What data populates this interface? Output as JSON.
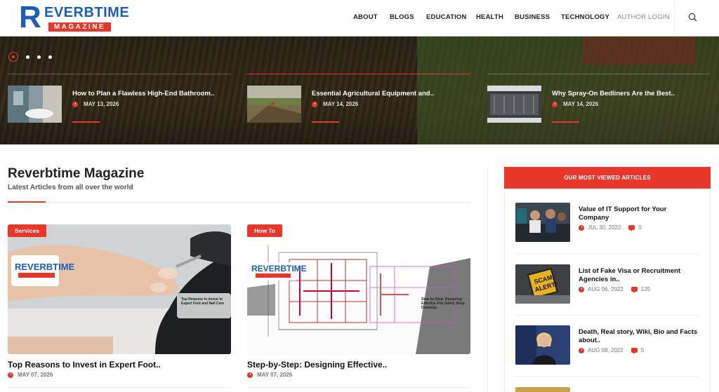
{
  "logo": {
    "letter": "R",
    "top_word": "EVERBTIME",
    "sub_word": "MAGAZINE"
  },
  "nav": [
    "ABOUT",
    "BLOGS",
    "EDUCATION",
    "HEALTH",
    "BUSINESS",
    "TECHNOLOGY",
    "AUTHOR LOGIN"
  ],
  "hero": {
    "items": [
      {
        "title": "How to Plan a Flawless High-End Bathroom..",
        "date": "MAY 13, 2026"
      },
      {
        "title": "Essential Agricultural Equipment and..",
        "date": "MAY 14, 2026"
      },
      {
        "title": "Why Spray-On Bedliners Are the Best..",
        "date": "MAY 14, 2026"
      }
    ]
  },
  "main": {
    "title": "Reverbtime Magazine",
    "subtitle": "Latest Articles from all over the world",
    "cards": [
      {
        "tag": "Services",
        "title": "Top Reasons to Invest in Expert Foot..",
        "date": "MAY 07, 2026",
        "overlay": "Top Reasons to Invest in Expert Foot and Nail Care"
      },
      {
        "tag": "How To",
        "title": "Step-by-Step: Designing Effective..",
        "date": "MAY 07, 2026",
        "overlay": "Step-by-Step: Designing Effective Fire Safety Shop Drawings"
      }
    ]
  },
  "sidebar": {
    "heading": "OUR MOST VIEWED ARTICLES",
    "items": [
      {
        "title": "Value of IT Support for Your Company",
        "date": "JUL 30, 2022",
        "comments": "0"
      },
      {
        "title": "List of Fake Visa or Recruitment Agencies in..",
        "date": "AUG 06, 2022",
        "comments": "135"
      },
      {
        "title": "Death, Real story, Wiki, Bio and Facts about..",
        "date": "AUG 08, 2022",
        "comments": "5"
      }
    ]
  },
  "colors": {
    "accent": "#e5382b",
    "brand_blue": "#1c5fb8"
  }
}
